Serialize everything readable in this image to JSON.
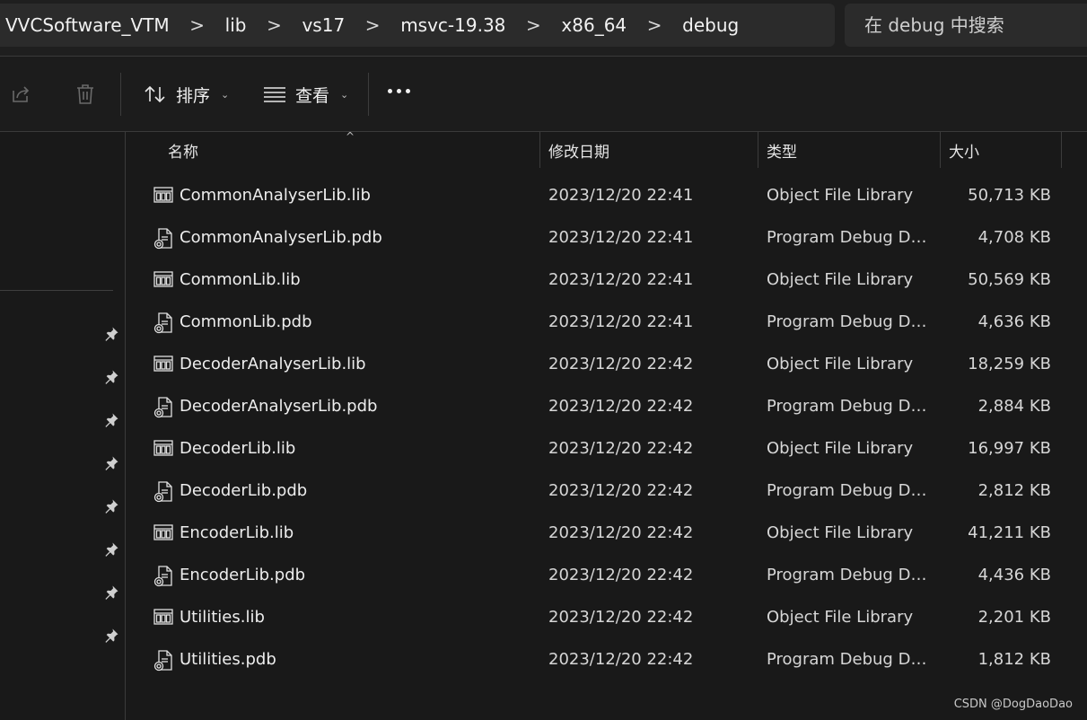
{
  "breadcrumb": [
    "VVCSoftware_VTM",
    "lib",
    "vs17",
    "msvc-19.38",
    "x86_64",
    "debug"
  ],
  "breadcrumb_separator": ">",
  "search": {
    "placeholder": "在 debug 中搜索"
  },
  "toolbar": {
    "share_icon": "share-icon",
    "delete_icon": "trash-icon",
    "sort_label": "排序",
    "view_label": "查看",
    "more_icon": "more-icon"
  },
  "columns": {
    "name": "名称",
    "modified": "修改日期",
    "type": "类型",
    "size": "大小"
  },
  "files": [
    {
      "name": "CommonAnalyserLib.lib",
      "modified": "2023/12/20 22:41",
      "type": "Object File Library",
      "size": "50,713 KB",
      "kind": "lib"
    },
    {
      "name": "CommonAnalyserLib.pdb",
      "modified": "2023/12/20 22:41",
      "type": "Program Debug Database",
      "size": "4,708 KB",
      "kind": "pdb"
    },
    {
      "name": "CommonLib.lib",
      "modified": "2023/12/20 22:41",
      "type": "Object File Library",
      "size": "50,569 KB",
      "kind": "lib"
    },
    {
      "name": "CommonLib.pdb",
      "modified": "2023/12/20 22:41",
      "type": "Program Debug Database",
      "size": "4,636 KB",
      "kind": "pdb"
    },
    {
      "name": "DecoderAnalyserLib.lib",
      "modified": "2023/12/20 22:42",
      "type": "Object File Library",
      "size": "18,259 KB",
      "kind": "lib"
    },
    {
      "name": "DecoderAnalyserLib.pdb",
      "modified": "2023/12/20 22:42",
      "type": "Program Debug Database",
      "size": "2,884 KB",
      "kind": "pdb"
    },
    {
      "name": "DecoderLib.lib",
      "modified": "2023/12/20 22:42",
      "type": "Object File Library",
      "size": "16,997 KB",
      "kind": "lib"
    },
    {
      "name": "DecoderLib.pdb",
      "modified": "2023/12/20 22:42",
      "type": "Program Debug Database",
      "size": "2,812 KB",
      "kind": "pdb"
    },
    {
      "name": "EncoderLib.lib",
      "modified": "2023/12/20 22:42",
      "type": "Object File Library",
      "size": "41,211 KB",
      "kind": "lib"
    },
    {
      "name": "EncoderLib.pdb",
      "modified": "2023/12/20 22:42",
      "type": "Program Debug Database",
      "size": "4,436 KB",
      "kind": "pdb"
    },
    {
      "name": "Utilities.lib",
      "modified": "2023/12/20 22:42",
      "type": "Object File Library",
      "size": "2,201 KB",
      "kind": "lib"
    },
    {
      "name": "Utilities.pdb",
      "modified": "2023/12/20 22:42",
      "type": "Program Debug Database",
      "size": "1,812 KB",
      "kind": "pdb"
    }
  ],
  "nav_pins": 8,
  "watermark": "CSDN @DogDaoDao",
  "colors": {
    "background": "#191919",
    "panel": "#2b2b2b",
    "text": "#e6e6e6"
  }
}
